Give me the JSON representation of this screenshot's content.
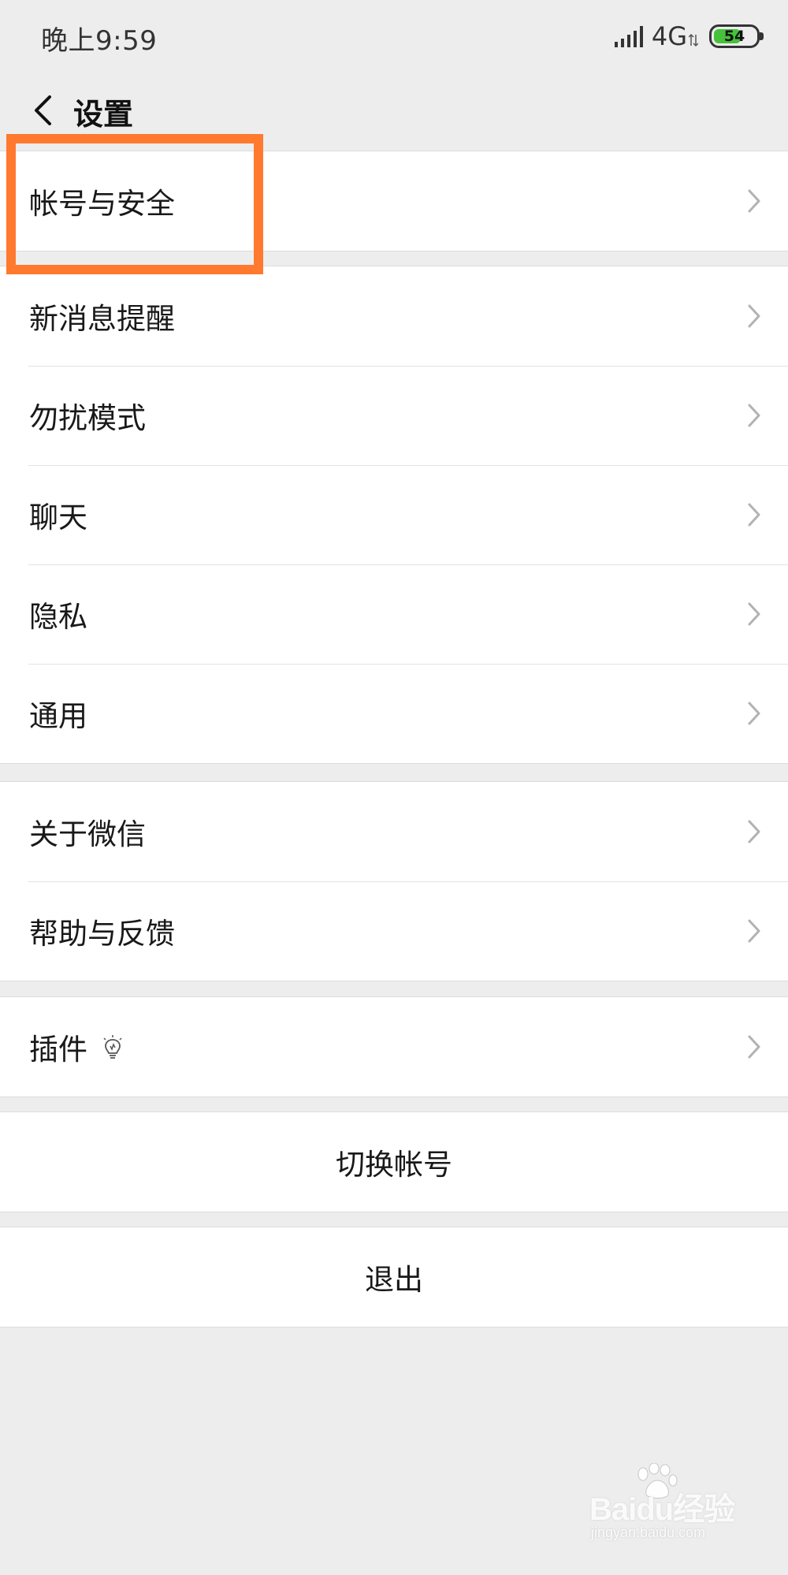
{
  "status_bar": {
    "time": "晚上9:59",
    "network": "4G",
    "battery_level": "54",
    "battery_color": "#45c23a"
  },
  "nav": {
    "back_icon": "chevron-left-icon",
    "title": "设置"
  },
  "groups": [
    {
      "items": [
        {
          "label": "帐号与安全",
          "icon": "chevron-right-icon"
        }
      ]
    },
    {
      "items": [
        {
          "label": "新消息提醒",
          "icon": "chevron-right-icon"
        },
        {
          "label": "勿扰模式",
          "icon": "chevron-right-icon"
        },
        {
          "label": "聊天",
          "icon": "chevron-right-icon"
        },
        {
          "label": "隐私",
          "icon": "chevron-right-icon"
        },
        {
          "label": "通用",
          "icon": "chevron-right-icon"
        }
      ]
    },
    {
      "items": [
        {
          "label": "关于微信",
          "icon": "chevron-right-icon"
        },
        {
          "label": "帮助与反馈",
          "icon": "chevron-right-icon"
        }
      ]
    },
    {
      "items": [
        {
          "label": "插件",
          "badge_icon": "lightbulb-icon",
          "icon": "chevron-right-icon"
        }
      ]
    }
  ],
  "actions": {
    "switch_account": "切换帐号",
    "logout": "退出"
  },
  "highlight_color": "#ff7a2e",
  "watermark": {
    "text": "Baidu经验",
    "url": "jingyan.baidu.com"
  }
}
